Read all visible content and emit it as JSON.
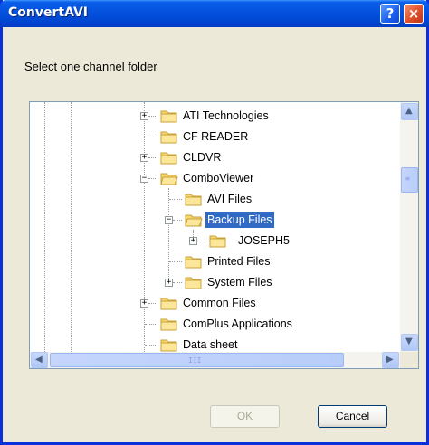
{
  "window": {
    "title": "ConvertAVI",
    "help_label": "?",
    "close_label": "×"
  },
  "prompt": "Select one channel folder",
  "tree": {
    "items": [
      {
        "label": "ATI Technologies",
        "expander": "+"
      },
      {
        "label": "CF READER",
        "expander": ""
      },
      {
        "label": "CLDVR",
        "expander": "+"
      },
      {
        "label": "ComboViewer",
        "expander": "−"
      },
      {
        "label": "AVI Files",
        "expander": ""
      },
      {
        "label": "Backup Files",
        "expander": "−",
        "selected": true
      },
      {
        "label": "JOSEPH5",
        "expander": "+"
      },
      {
        "label": "Printed Files",
        "expander": ""
      },
      {
        "label": "System Files",
        "expander": "+"
      },
      {
        "label": "Common Files",
        "expander": "+"
      },
      {
        "label": "ComPlus Applications",
        "expander": ""
      },
      {
        "label": "Data sheet",
        "expander": ""
      }
    ]
  },
  "scroll": {
    "up": "▲",
    "down": "▼",
    "left": "◀",
    "right": "▶",
    "grip_v": "≡",
    "grip_h": "III"
  },
  "buttons": {
    "ok": "OK",
    "cancel": "Cancel"
  },
  "colors": {
    "selection": "#316ac5",
    "titlebar": "#0553e0",
    "folder": "#f5d76e"
  }
}
